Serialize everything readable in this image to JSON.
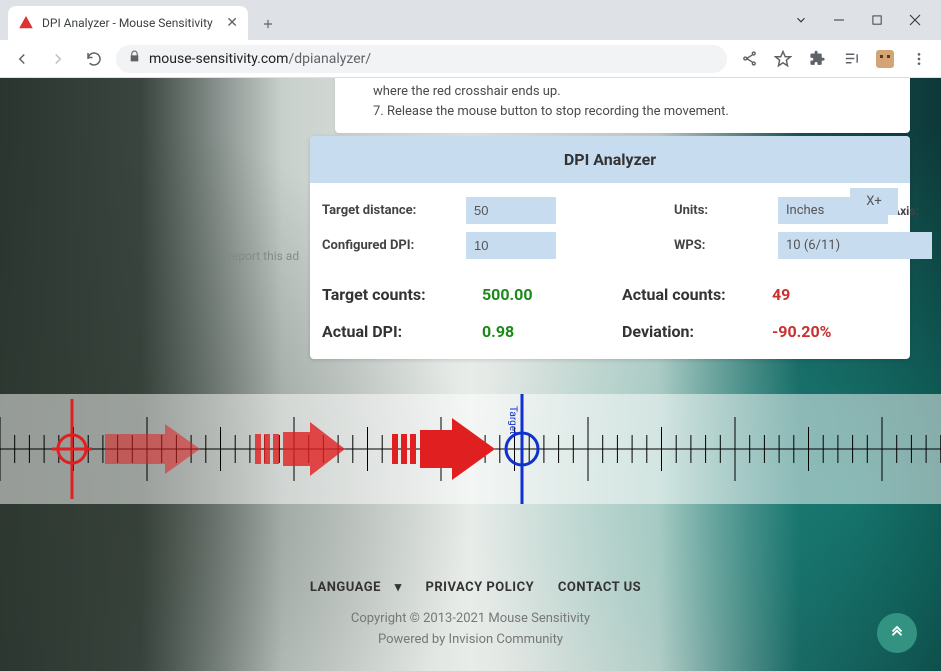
{
  "browser": {
    "tab_title": "DPI Analyzer - Mouse Sensitivity",
    "url_host": "mouse-sensitivity.com",
    "url_path": "/dpianalyzer/"
  },
  "instructions": {
    "line6_partial": "where the red crosshair ends up.",
    "item7_num": "7.",
    "item7_text": "Release the mouse button to stop recording the movement."
  },
  "report_ad": "report this ad",
  "panel": {
    "header": "DPI Analyzer",
    "labels": {
      "target_distance": "Target distance:",
      "configured_dpi": "Configured DPI:",
      "units": "Units:",
      "axis": "Axis:",
      "wps": "WPS:"
    },
    "values": {
      "target_distance": "50",
      "configured_dpi": "10",
      "units": "Inches",
      "axis": "X+",
      "wps": "10 (6/11)"
    }
  },
  "results": {
    "target_counts_label": "Target counts:",
    "target_counts_value": "500.00",
    "actual_counts_label": "Actual counts:",
    "actual_counts_value": "49",
    "actual_dpi_label": "Actual DPI:",
    "actual_dpi_value": "0.98",
    "deviation_label": "Deviation:",
    "deviation_value": "-90.20%"
  },
  "ruler": {
    "target_label": "Target"
  },
  "footer": {
    "language": "LANGUAGE",
    "privacy": "PRIVACY POLICY",
    "contact": "CONTACT US",
    "copyright": "Copyright © 2013-2021 Mouse Sensitivity",
    "powered": "Powered by Invision Community"
  }
}
